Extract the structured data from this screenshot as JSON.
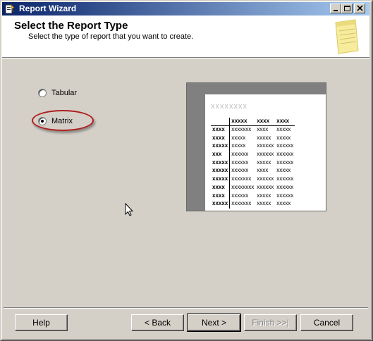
{
  "window": {
    "title": "Report Wizard"
  },
  "header": {
    "title": "Select the Report Type",
    "subtitle": "Select the type of report that you want to create."
  },
  "options": [
    {
      "label": "Tabular",
      "selected": false
    },
    {
      "label": "Matrix",
      "selected": true
    }
  ],
  "preview": {
    "heading": "xxxxxxxx",
    "columns": [
      "xxxxx",
      "xxxx",
      "xxxx"
    ],
    "rows": [
      [
        "xxxx",
        "xxxxxxx",
        "xxxx",
        "xxxxx"
      ],
      [
        "xxxx",
        "xxxxx",
        "xxxxx",
        "xxxxx"
      ],
      [
        "xxxxx",
        "xxxxx",
        "xxxxxx",
        "xxxxxx"
      ],
      [
        "xxx",
        "xxxxxx",
        "xxxxxx",
        "xxxxxx"
      ],
      [
        "xxxxx",
        "xxxxxx",
        "xxxxx",
        "xxxxxx"
      ],
      [
        "xxxxx",
        "xxxxxx",
        "xxxx",
        "xxxxx"
      ],
      [
        "xxxxx",
        "xxxxxxx",
        "xxxxxx",
        "xxxxxx"
      ],
      [
        "xxxx",
        "xxxxxxxx",
        "xxxxxx",
        "xxxxxx"
      ],
      [
        "xxxx",
        "xxxxxx",
        "xxxxx",
        "xxxxxx"
      ],
      [
        "xxxxx",
        "xxxxxxx",
        "xxxxx",
        "xxxxx"
      ]
    ]
  },
  "buttons": {
    "help": "Help",
    "back": "< Back",
    "next": "Next >",
    "finish": "Finish >>|",
    "cancel": "Cancel"
  },
  "colors": {
    "titlebar_start": "#0a246a",
    "titlebar_end": "#a6caf0",
    "highlight": "#b01e1e",
    "face": "#d4d0c8"
  },
  "icons": [
    "report-wizard-icon",
    "minimize-icon",
    "maximize-icon",
    "close-icon",
    "notepad-icon",
    "mouse-cursor-icon"
  ]
}
